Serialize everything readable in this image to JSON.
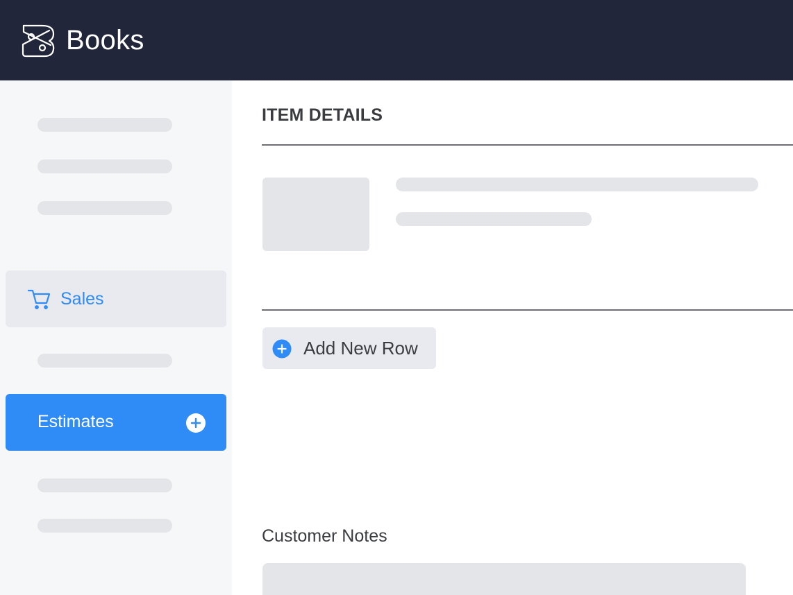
{
  "header": {
    "app_name": "Books",
    "logo_icon": "books-logo-icon",
    "background_color": "#22263a"
  },
  "sidebar": {
    "sales": {
      "label": "Sales",
      "icon": "cart-icon"
    },
    "estimates": {
      "label": "Estimates",
      "icon": "plus-circle-icon"
    },
    "accent_color": "#2f8bf5"
  },
  "main": {
    "item_details_title": "ITEM DETAILS",
    "add_row_label": "Add New Row",
    "add_row_icon": "plus-circle-icon",
    "customer_notes_label": "Customer Notes"
  }
}
